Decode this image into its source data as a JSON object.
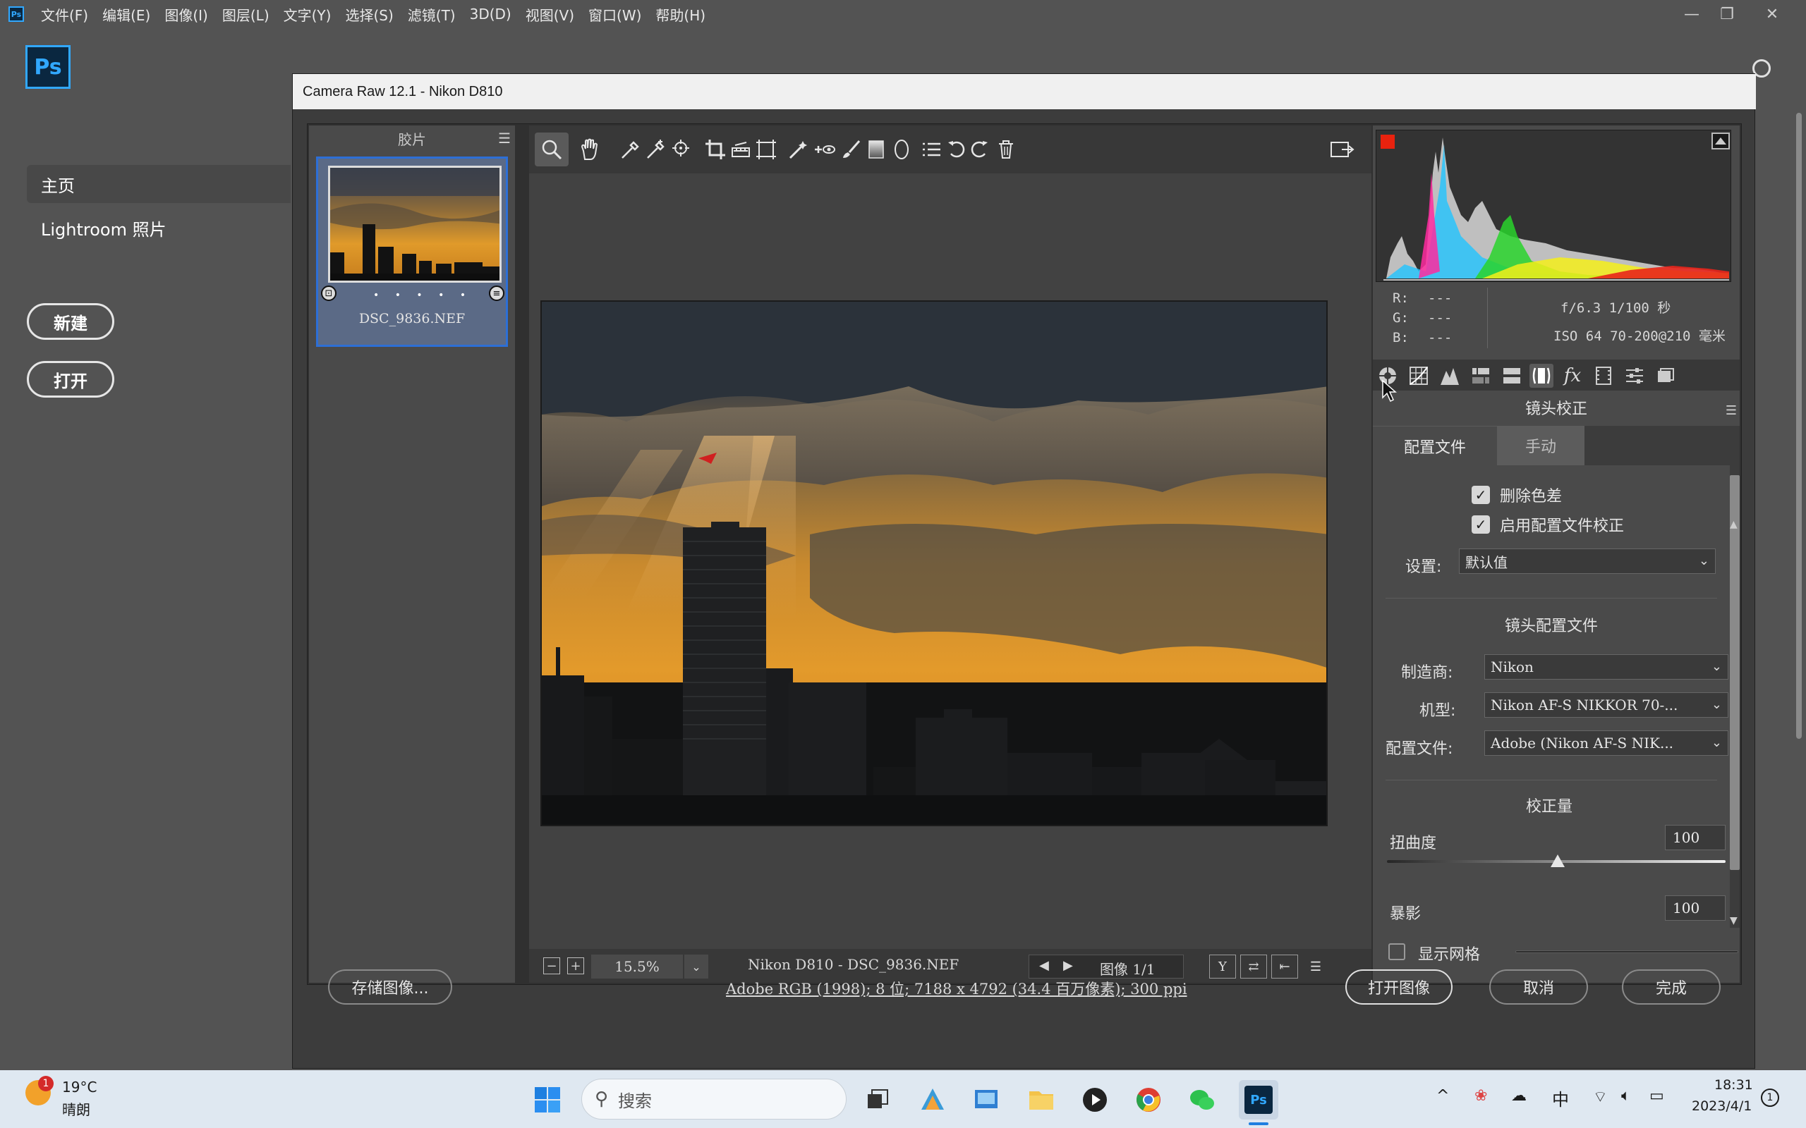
{
  "menubar": {
    "app_icon": "Ps",
    "items": [
      "文件(F)",
      "编辑(E)",
      "图像(I)",
      "图层(L)",
      "文字(Y)",
      "选择(S)",
      "滤镜(T)",
      "3D(D)",
      "视图(V)",
      "窗口(W)",
      "帮助(H)"
    ],
    "window_controls": [
      "—",
      "❐",
      "✕"
    ]
  },
  "home": {
    "logo": "Ps",
    "nav_home": "主页",
    "nav_lightroom": "Lightroom 照片",
    "new_button": "新建",
    "open_button": "打开"
  },
  "dialog": {
    "title": "Camera Raw 12.1 -  Nikon D810",
    "filmstrip": {
      "header": "胶片",
      "thumbnail_name": "DSC_9836.NEF",
      "rating_dots": "• • • • •"
    },
    "statusbar": {
      "zoom_value": "15.5%",
      "file_label": "Nikon D810 -  DSC_9836.NEF",
      "image_count": "图像 1/1"
    },
    "readout": {
      "r_label": "R:",
      "r_value": "---",
      "g_label": "G:",
      "g_value": "---",
      "b_label": "B:",
      "b_value": "---",
      "aperture_shutter": "f/6.3  1/100 秒",
      "iso_lens": "ISO 64  70-200@210 毫米"
    },
    "lens_panel": {
      "section_title": "镜头校正",
      "tab_profile": "配置文件",
      "tab_manual": "手动",
      "remove_ca": "删除色差",
      "enable_profile": "启用配置文件校正",
      "setup_label": "设置:",
      "setup_value": "默认值",
      "lens_profile_heading": "镜头配置文件",
      "make_label": "制造商:",
      "make_value": "Nikon",
      "model_label": "机型:",
      "model_value": "Nikon AF-S NIKKOR 70-...",
      "profile_label": "配置文件:",
      "profile_value": "Adobe (Nikon AF-S NIK...",
      "amount_heading": "校正量",
      "distortion_label": "扭曲度",
      "distortion_value": "100",
      "vignette_label": "暴影",
      "vignette_value": "100",
      "show_grid": "显示网格"
    },
    "buttons": {
      "save": "存储图像...",
      "open": "打开图像",
      "cancel": "取消",
      "done": "完成"
    },
    "info_link": "Adobe RGB (1998); 8 位;  7188 x 4792 (34.4 百万像素); 300 ppi"
  },
  "taskbar": {
    "weather_temp": "19°C",
    "weather_desc": "晴朗",
    "weather_badge": "1",
    "search_placeholder": "搜索",
    "ime": "中",
    "time": "18:31",
    "date": "2023/4/1",
    "notification_count": "1"
  },
  "colors": {
    "ps_blue": "#31a8ff",
    "selection_blue": "#2d6fd6",
    "panel_bg": "#4a4a4a"
  }
}
